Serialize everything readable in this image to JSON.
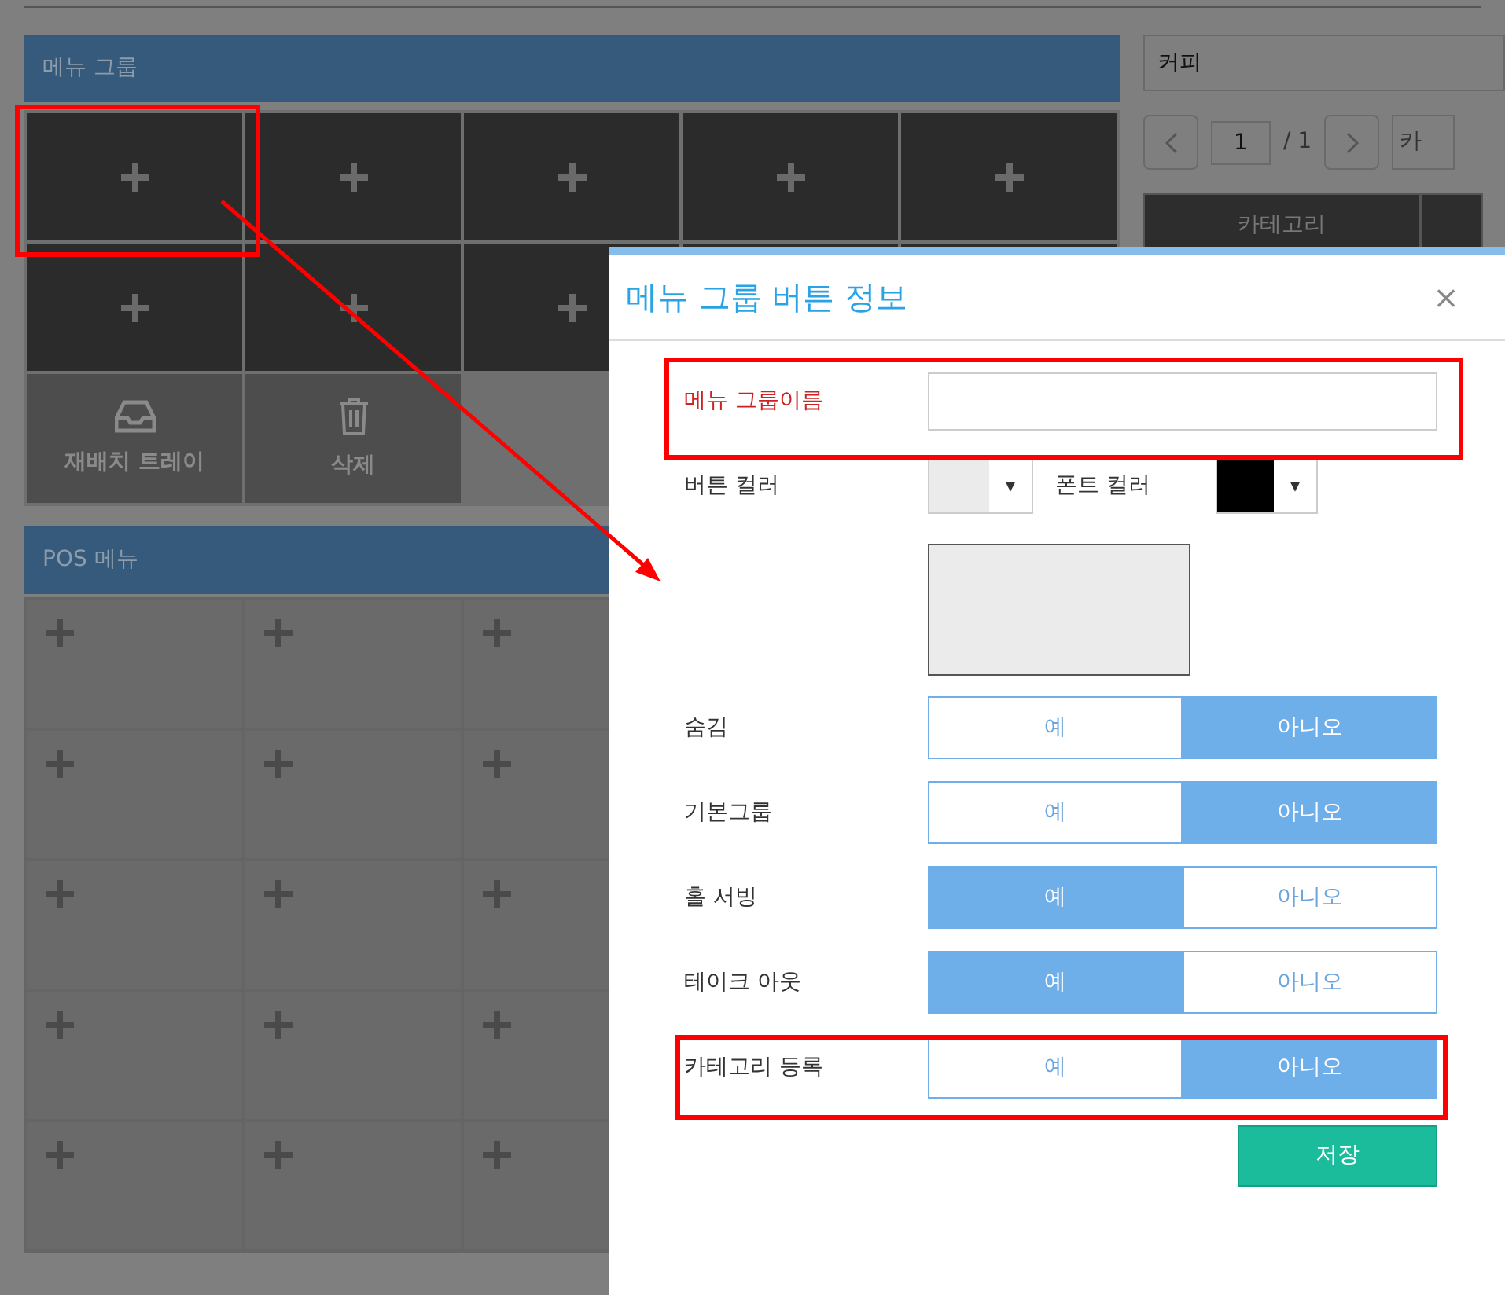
{
  "menu_group": {
    "title": "메뉴 그룹",
    "actions": [
      {
        "kind": "tray",
        "label": "재배치 트레이"
      },
      {
        "kind": "trash",
        "label": "삭제"
      }
    ]
  },
  "pos_menu": {
    "title": "POS 메뉴"
  },
  "category_panel": {
    "search_value": "커피",
    "pager": {
      "page": "1",
      "total": "/ 1"
    },
    "dropdown_value": "카",
    "table": {
      "columns": [
        "카테고리"
      ]
    }
  },
  "dialog": {
    "title": "메뉴 그룹 버튼 정보",
    "close": "×",
    "fields": [
      {
        "kind": "text",
        "label": "메뉴 그룹이름",
        "required": true
      },
      {
        "kind": "colors",
        "label": "버튼 컬러",
        "caret": "▾",
        "font_label": "폰트 컬러",
        "font_caret": "▾"
      },
      {
        "kind": "preview"
      },
      {
        "kind": "toggle",
        "label": "숨김",
        "options": [
          {
            "label": "예",
            "selected": false
          },
          {
            "label": "아니오",
            "selected": true
          }
        ]
      },
      {
        "kind": "toggle",
        "label": "기본그룹",
        "options": [
          {
            "label": "예",
            "selected": false
          },
          {
            "label": "아니오",
            "selected": true
          }
        ]
      },
      {
        "kind": "toggle",
        "label": "홀 서빙",
        "options": [
          {
            "label": "예",
            "selected": true
          },
          {
            "label": "아니오",
            "selected": false
          }
        ]
      },
      {
        "kind": "toggle",
        "label": "테이크 아웃",
        "options": [
          {
            "label": "예",
            "selected": true
          },
          {
            "label": "아니오",
            "selected": false
          }
        ]
      },
      {
        "kind": "toggle",
        "label": "카테고리 등록",
        "options": [
          {
            "label": "예",
            "selected": false
          },
          {
            "label": "아니오",
            "selected": true
          }
        ]
      }
    ],
    "save": "저장"
  }
}
